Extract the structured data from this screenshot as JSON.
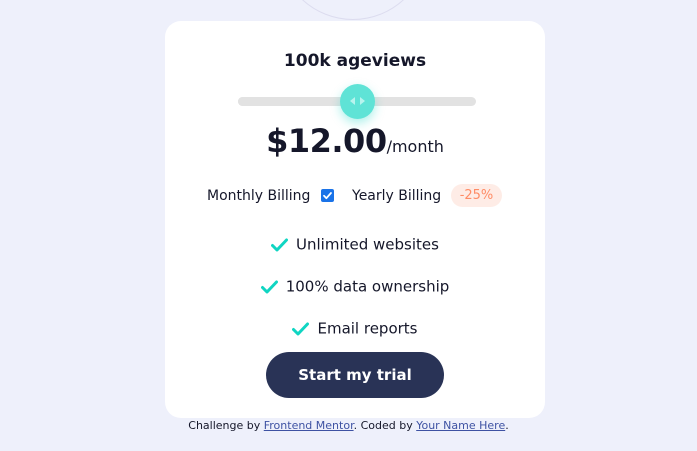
{
  "colors": {
    "page_bg": "#eef0fb",
    "card_bg": "#ffffff",
    "accent_thumb": "#5fe3d6",
    "check": "#10d5c2",
    "discount_text": "#ff8c66",
    "discount_bg": "#feece6",
    "button_bg": "#293356",
    "link": "#3e52a3"
  },
  "pricing": {
    "pageviews_label": "100k ageviews",
    "slider": {
      "fraction": 0.5
    },
    "price": "$12.00",
    "period": "/month",
    "billing": {
      "monthly_label": "Monthly Billing",
      "yearly_label": "Yearly Billing",
      "checked": true,
      "discount": "-25%"
    },
    "features": [
      "Unlimited websites",
      "100% data ownership",
      "Email reports"
    ],
    "icons": {
      "feature": "check-icon",
      "thumb": "slider-arrows-icon"
    },
    "cta_label": "Start my trial"
  },
  "footer": {
    "prefix": "Challenge by ",
    "fm_link": "Frontend Mentor",
    "middle": ". Coded by ",
    "author_link": "Your Name Here",
    "suffix": "."
  }
}
